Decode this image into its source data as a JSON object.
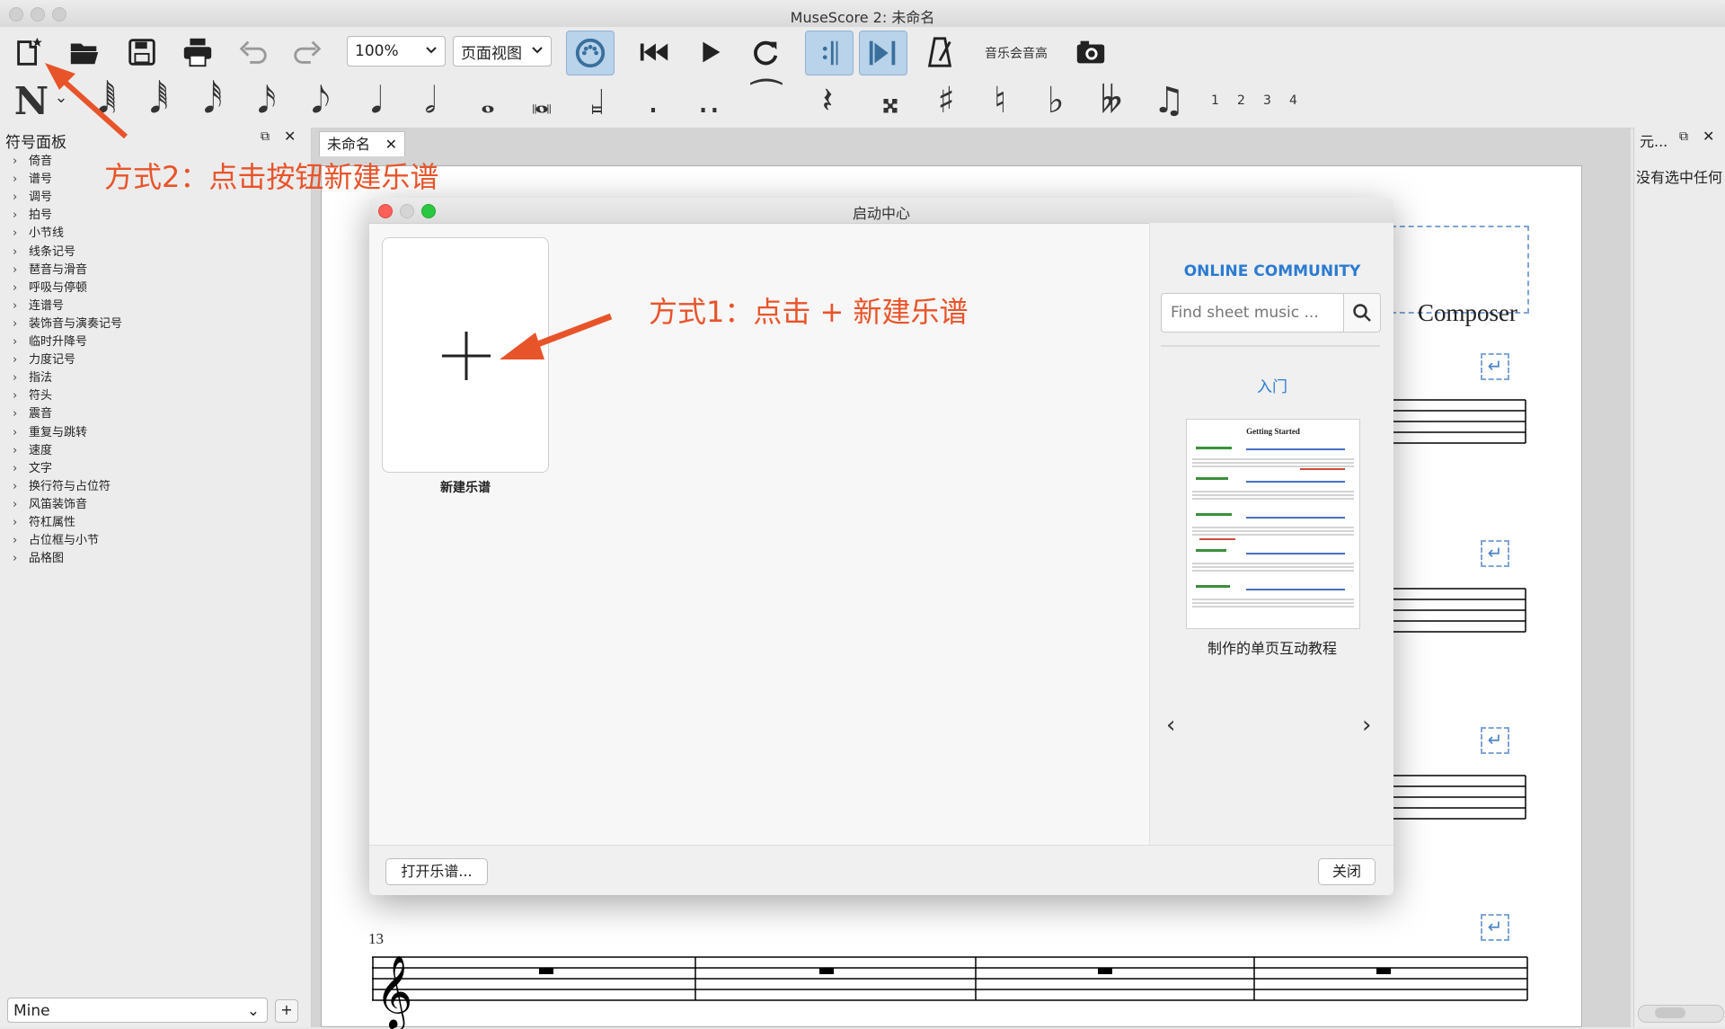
{
  "window": {
    "title": "MuseScore 2: 未命名"
  },
  "toolbar": {
    "zoom_value": "100%",
    "view_mode": "页面视图",
    "concert_pitch_label": "音乐会音高",
    "note_input_glyph": "N",
    "voice_labels": [
      "1",
      "2",
      "3",
      "4"
    ]
  },
  "palette": {
    "title": "符号面板",
    "items": [
      "倚音",
      "谱号",
      "调号",
      "拍号",
      "小节线",
      "线条记号",
      "琶音与滑音",
      "呼吸与停顿",
      "连谱号",
      "装饰音与演奏记号",
      "临时升降号",
      "力度记号",
      "指法",
      "符头",
      "震音",
      "重复与跳转",
      "速度",
      "文字",
      "换行符与占位符",
      "风笛装饰音",
      "符杠属性",
      "占位框与小节",
      "品格图"
    ],
    "workspace": "Mine",
    "add_label": "+"
  },
  "score": {
    "tab_title": "未命名",
    "tab_close": "✕",
    "composer": "Composer",
    "measure_number": "13"
  },
  "right_panel": {
    "title": "元...",
    "message": "没有选中任何"
  },
  "dialog": {
    "title": "启动中心",
    "new_score_label": "新建乐谱",
    "community_title": "ONLINE COMMUNITY",
    "search_placeholder": "Find sheet music ...",
    "getting_started": "入门",
    "tutorial_label": "制作的单页互动教程",
    "thumb_title": "Getting Started",
    "open_button": "打开乐谱...",
    "close_button": "关闭"
  },
  "annotations": {
    "method2": "方式2：点击按钮新建乐谱",
    "method1": "方式1：点击 + 新建乐谱"
  },
  "colors": {
    "accent_link": "#2b7bd1",
    "annotation": "#e8542a",
    "toggle_active": "#b8d3ea"
  }
}
